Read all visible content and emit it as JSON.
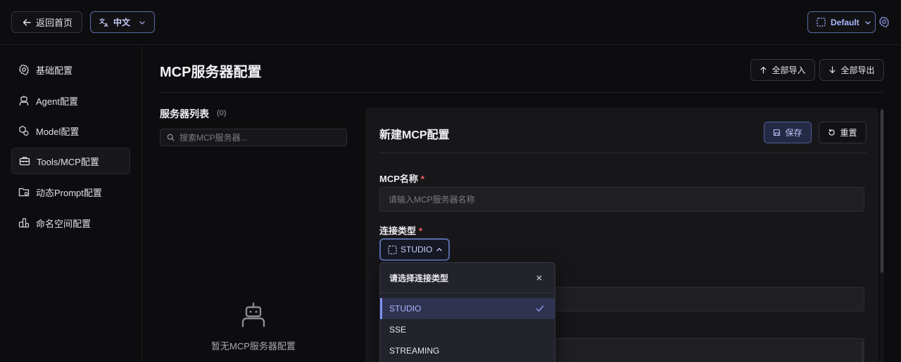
{
  "topbar": {
    "back_label": "返回首页",
    "language_label": "中文",
    "namespace_label": "Default"
  },
  "sidebar": {
    "items": [
      {
        "label": "基础配置",
        "icon": "gear-icon"
      },
      {
        "label": "Agent配置",
        "icon": "agent-icon"
      },
      {
        "label": "Model配置",
        "icon": "model-icon"
      },
      {
        "label": "Tools/MCP配置",
        "icon": "toolbox-icon",
        "active": true
      },
      {
        "label": "动态Prompt配置",
        "icon": "folder-prompt-icon"
      },
      {
        "label": "命名空间配置",
        "icon": "namespace-icon"
      }
    ]
  },
  "main": {
    "title": "MCP服务器配置",
    "import_all": "全部导入",
    "export_all": "全部导出"
  },
  "server_list": {
    "title": "服务器列表",
    "count": "(0)",
    "search_placeholder": "搜索MCP服务器...",
    "empty_text": "暂无MCP服务器配置"
  },
  "config_panel": {
    "title": "新建MCP配置",
    "save_label": "保存",
    "reset_label": "重置",
    "name_label": "MCP名称",
    "name_placeholder": "请输入MCP服务器名称",
    "type_label": "连接类型",
    "type_value": "STUDIO",
    "required_mark": "*"
  },
  "dropdown": {
    "title": "请选择连接类型",
    "close": "×",
    "options": [
      {
        "label": "STUDIO",
        "selected": true
      },
      {
        "label": "SSE",
        "selected": false
      },
      {
        "label": "STREAMING",
        "selected": false
      }
    ]
  },
  "colors": {
    "accent": "#7f8ff0",
    "required": "#ff5d5d",
    "background": "#0d0d0f"
  }
}
